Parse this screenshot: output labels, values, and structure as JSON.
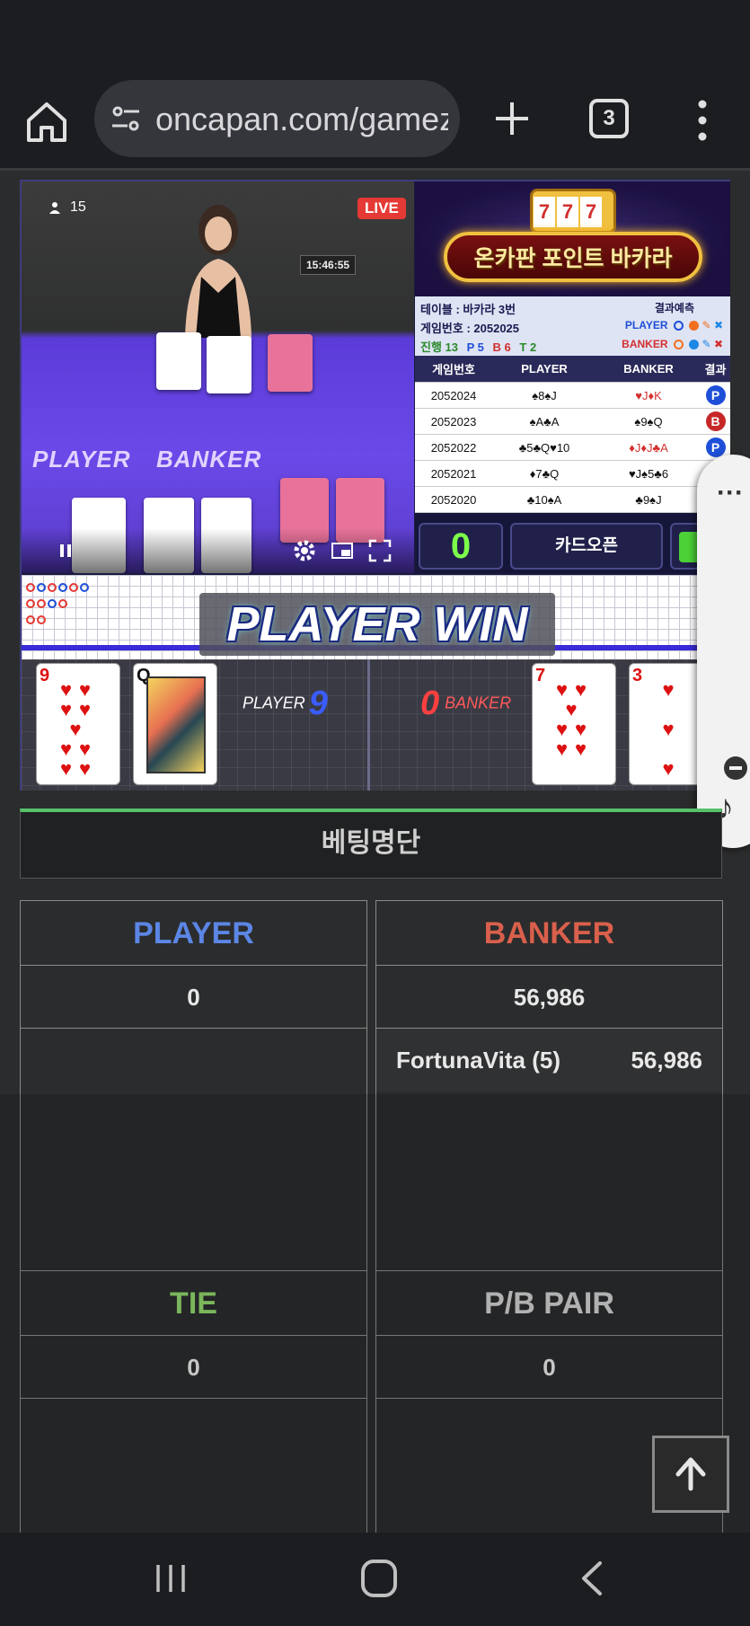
{
  "browser": {
    "url": "oncapan.com/gamez",
    "tab_count": "3"
  },
  "video": {
    "viewers": "15",
    "live_badge": "LIVE",
    "clock": "15:46:55",
    "felt_player": "PLAYER",
    "felt_banker": "BANKER"
  },
  "side": {
    "banner_title": "온카판 포인트 바카라",
    "slot_digits": [
      "7",
      "7",
      "7"
    ],
    "info": {
      "table": "테이블 : 바카라 3번",
      "game_no": "게임번호 : 2052025",
      "progress_label": "진행 13",
      "p_count": "P 5",
      "b_count": "B 6",
      "t_count": "T 2",
      "prediction_title": "결과예측",
      "player_label": "PLAYER",
      "banker_label": "BANKER"
    },
    "history_headers": [
      "게임번호",
      "PLAYER",
      "BANKER",
      "결과"
    ],
    "history": [
      {
        "no": "2052024",
        "player": "♠8♠J",
        "banker": "♥J♦K",
        "result": "P"
      },
      {
        "no": "2052023",
        "player": "♠A♣A",
        "banker": "♠9♠Q",
        "result": "B"
      },
      {
        "no": "2052022",
        "player": "♣5♣Q♥10",
        "banker": "♦J♦J♣A",
        "result": "P"
      },
      {
        "no": "2052021",
        "player": "♦7♣Q",
        "banker": "♥J♠5♣6",
        "result": ""
      },
      {
        "no": "2052020",
        "player": "♣10♠A",
        "banker": "♣9♠J",
        "result": ""
      }
    ],
    "count": "0",
    "open_label": "카드오픈"
  },
  "result": {
    "banner": "PLAYER WIN",
    "player_label": "PLAYER",
    "player_score": "9",
    "banker_label": "BANKER",
    "banker_score": "0",
    "player_cards": [
      {
        "rank": "9",
        "suit": "♥"
      },
      {
        "rank": "Q",
        "suit": "♣"
      }
    ],
    "banker_cards": [
      {
        "rank": "7",
        "suit": "♥"
      },
      {
        "rank": "3",
        "suit": "♥"
      }
    ]
  },
  "betting": {
    "title": "베팅명단",
    "player": {
      "header": "PLAYER",
      "total": "0"
    },
    "banker": {
      "header": "BANKER",
      "total": "56,986",
      "entries": [
        {
          "name": "FortunaVita (5)",
          "amount": "56,986"
        }
      ]
    },
    "tie": {
      "header": "TIE",
      "total": "0"
    },
    "pair": {
      "header": "P/B PAIR",
      "total": "0"
    }
  },
  "colors": {
    "player": "#5b86e5",
    "banker": "#d9604c",
    "tie": "#8ed46a",
    "pair": "#cfcfcf",
    "accent_green": "#56c26a"
  },
  "icons": {
    "home": "home-icon",
    "tune": "tune-icon",
    "plus": "plus-icon",
    "menu": "more-vert-icon",
    "scroll_top": "arrow-up-icon"
  }
}
